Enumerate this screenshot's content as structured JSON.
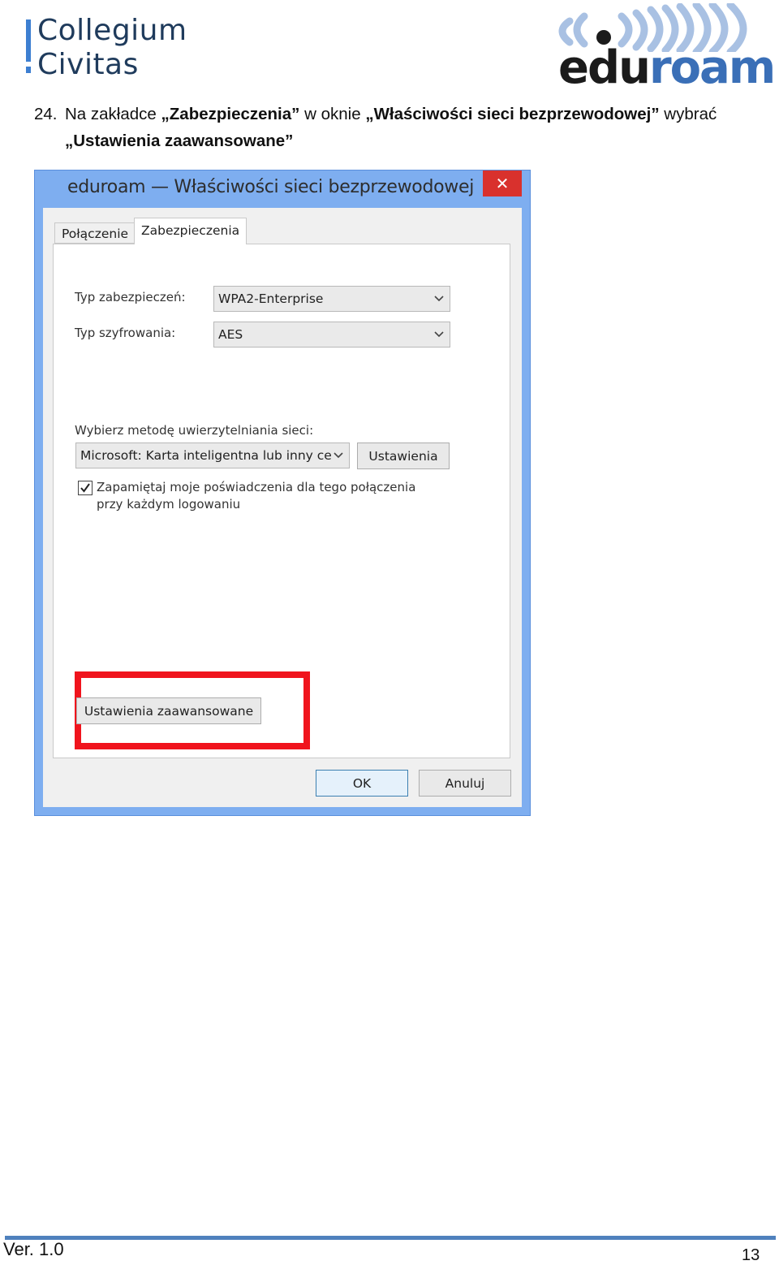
{
  "header": {
    "collegium_line1": "Collegium",
    "collegium_line2": "Civitas",
    "eduroam_part1": "ed",
    "eduroam_part2": "u",
    "eduroam_part3": "roam"
  },
  "instruction": {
    "number": "24.",
    "text_a": "Na zakładce ",
    "bold_a": "„Zabezpieczenia”",
    "text_b": " w oknie ",
    "bold_b": "„Właściwości sieci bezprzewodowej”",
    "text_c": " wybrać",
    "bold_c": "„Ustawienia zaawansowane”"
  },
  "dialog": {
    "title": "eduroam — Właściwości sieci bezprzewodowej",
    "close_glyph": "✕",
    "tabs": [
      {
        "label": "Połączenie"
      },
      {
        "label": "Zabezpieczenia"
      }
    ],
    "security_type_label": "Typ zabezpieczeń:",
    "security_type_value": "WPA2-Enterprise",
    "encryption_type_label": "Typ szyfrowania:",
    "encryption_type_value": "AES",
    "auth_method_label": "Wybierz metodę uwierzytelniania sieci:",
    "auth_method_value": "Microsoft: Karta inteligentna lub inny cer",
    "settings_button": "Ustawienia",
    "remember_checkbox_line1": "Zapamiętaj moje poświadczenia dla tego połączenia",
    "remember_checkbox_line2": "przy każdym logowaniu",
    "remember_checked": true,
    "advanced_settings_button": "Ustawienia zaawansowane",
    "ok_button": "OK",
    "cancel_button": "Anuluj"
  },
  "footer": {
    "version": "Ver. 1.0",
    "page_number": "13"
  },
  "colors": {
    "dialog_frame": "#7eaef0",
    "close_button": "#d9312d",
    "highlight_box": "#f0141d",
    "footer_rule": "#4f81bd",
    "eduroam_blue": "#3a6fb7"
  },
  "icons": [
    "collegium-civitas-logo",
    "eduroam-logo",
    "close-icon",
    "chevron-down-icon",
    "checkmark-icon"
  ]
}
